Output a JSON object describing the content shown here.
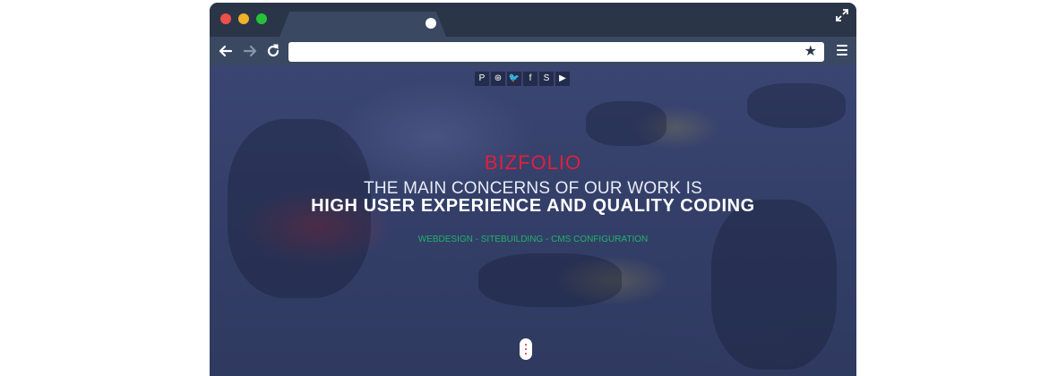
{
  "browser": {
    "controls": [
      "close",
      "minimize",
      "maximize"
    ],
    "icons": [
      "back-arrow-icon",
      "forward-arrow-icon",
      "reload-icon",
      "star-icon",
      "menu-icon",
      "expand-icon"
    ],
    "address_value": ""
  },
  "site": {
    "social_icons": [
      "P",
      "⊛",
      "🐦",
      "f",
      "S",
      "▶"
    ],
    "brand": "BIZFOLIO",
    "headline_line1": "THE MAIN CONCERNS OF OUR WORK IS",
    "headline_line2": "HIGH USER EXPERIENCE AND QUALITY CODING",
    "services": "WEBDESIGN - SITEBUILDING - CMS CONFIGURATION"
  },
  "colors": {
    "brand": "#e21f3b",
    "services": "#1fb36a",
    "overlay": "#343f69",
    "chrome": "#2b3548"
  }
}
